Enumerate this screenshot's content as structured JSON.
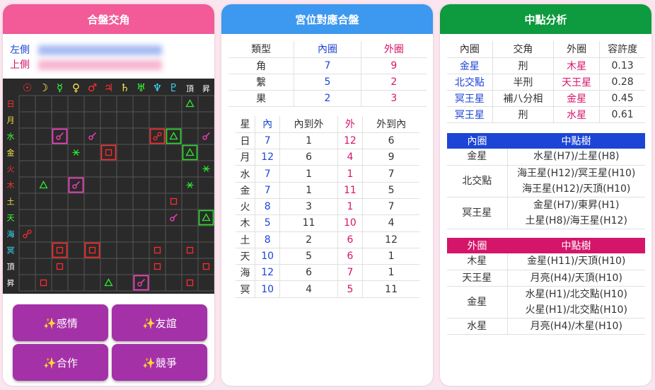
{
  "panel1": {
    "title": "合盤交角",
    "left_label": "左側",
    "right_label": "上側",
    "glyphs_top": [
      "☉",
      "☽",
      "☿",
      "♀",
      "♂",
      "♃",
      "♄",
      "♅",
      "♆",
      "♇",
      "頂",
      "昇"
    ],
    "glyph_colors": [
      "#ff3030",
      "#ffe64a",
      "#3cff3c",
      "#ffe64a",
      "#ff3030",
      "#ff3030",
      "#ffe64a",
      "#3cff3c",
      "#39e0ff",
      "#39e0ff",
      "#ffffff",
      "#ffffff"
    ],
    "rows": [
      "日",
      "月",
      "水",
      "金",
      "火",
      "木",
      "土",
      "天",
      "海",
      "冥",
      "頂",
      "昇"
    ],
    "aspects": [
      {
        "r": 0,
        "c": 10,
        "t": "tri"
      },
      {
        "r": 2,
        "c": 2,
        "t": "con",
        "box": "pink"
      },
      {
        "r": 2,
        "c": 4,
        "t": "con"
      },
      {
        "r": 2,
        "c": 8,
        "t": "opp",
        "box": "red"
      },
      {
        "r": 2,
        "c": 9,
        "t": "tri",
        "box": "green"
      },
      {
        "r": 2,
        "c": 11,
        "t": "con"
      },
      {
        "r": 3,
        "c": 3,
        "t": "sex"
      },
      {
        "r": 3,
        "c": 5,
        "t": "sq",
        "box": "red"
      },
      {
        "r": 3,
        "c": 10,
        "t": "tri",
        "box": "green"
      },
      {
        "r": 4,
        "c": 11,
        "t": "sex"
      },
      {
        "r": 5,
        "c": 1,
        "t": "tri"
      },
      {
        "r": 5,
        "c": 3,
        "t": "con",
        "box": "pink"
      },
      {
        "r": 5,
        "c": 10,
        "t": "sex"
      },
      {
        "r": 6,
        "c": 9,
        "t": "sq"
      },
      {
        "r": 7,
        "c": 9,
        "t": "con"
      },
      {
        "r": 7,
        "c": 11,
        "t": "tri",
        "box": "green"
      },
      {
        "r": 8,
        "c": 0,
        "t": "opp"
      },
      {
        "r": 9,
        "c": 2,
        "t": "sq",
        "box": "red"
      },
      {
        "r": 9,
        "c": 4,
        "t": "sq",
        "box": "red"
      },
      {
        "r": 9,
        "c": 8,
        "t": "sq"
      },
      {
        "r": 9,
        "c": 10,
        "t": "sq"
      },
      {
        "r": 10,
        "c": 2,
        "t": "sq"
      },
      {
        "r": 10,
        "c": 8,
        "t": "sq"
      },
      {
        "r": 10,
        "c": 11,
        "t": "sq"
      },
      {
        "r": 11,
        "c": 1,
        "t": "sq"
      },
      {
        "r": 11,
        "c": 5,
        "t": "tri"
      },
      {
        "r": 11,
        "c": 7,
        "t": "con",
        "box": "pink"
      },
      {
        "r": 11,
        "c": 10,
        "t": "sq"
      }
    ],
    "buttons": [
      "✨感情",
      "✨友誼",
      "✨合作",
      "✨競爭"
    ]
  },
  "panel2": {
    "title": "宮位對應合盤",
    "summary_headers": [
      "類型",
      "內圈",
      "外圈"
    ],
    "summary_rows": [
      [
        "角",
        "7",
        "9"
      ],
      [
        "繫",
        "5",
        "2"
      ],
      [
        "果",
        "2",
        "3"
      ]
    ],
    "detail_headers": [
      "星",
      "內",
      "內到外",
      "外",
      "外到內"
    ],
    "detail_rows": [
      [
        "日",
        "7",
        "1",
        "12",
        "6"
      ],
      [
        "月",
        "12",
        "6",
        "4",
        "9"
      ],
      [
        "水",
        "7",
        "1",
        "1",
        "7"
      ],
      [
        "金",
        "7",
        "1",
        "11",
        "5"
      ],
      [
        "火",
        "8",
        "3",
        "1",
        "7"
      ],
      [
        "木",
        "5",
        "11",
        "10",
        "4"
      ],
      [
        "土",
        "8",
        "2",
        "6",
        "12"
      ],
      [
        "天",
        "10",
        "5",
        "6",
        "1"
      ],
      [
        "海",
        "12",
        "6",
        "7",
        "1"
      ],
      [
        "冥",
        "10",
        "4",
        "5",
        "11"
      ]
    ]
  },
  "panel3": {
    "title": "中點分析",
    "headers": [
      "內圈",
      "交角",
      "外圈",
      "容許度"
    ],
    "rows": [
      [
        "金星",
        "刑",
        "木星",
        "0.13"
      ],
      [
        "北交點",
        "半刑",
        "天王星",
        "0.28"
      ],
      [
        "冥王星",
        "補八分相",
        "金星",
        "0.45"
      ],
      [
        "冥王星",
        "刑",
        "水星",
        "0.61"
      ]
    ],
    "inner_header": [
      "內圈",
      "中點樹"
    ],
    "inner_rows": [
      {
        "k": "金星",
        "v": [
          "水星(H7)/土星(H8)"
        ]
      },
      {
        "k": "北交點",
        "v": [
          "海王星(H12)/冥王星(H10)",
          "海王星(H12)/天頂(H10)"
        ]
      },
      {
        "k": "冥王星",
        "v": [
          "金星(H7)/東昇(H1)",
          "土星(H8)/海王星(H12)"
        ]
      }
    ],
    "outer_header": [
      "外圈",
      "中點樹"
    ],
    "outer_rows": [
      {
        "k": "木星",
        "v": [
          "金星(H11)/天頂(H10)"
        ]
      },
      {
        "k": "天王星",
        "v": [
          "月亮(H4)/天頂(H10)"
        ]
      },
      {
        "k": "金星",
        "v": [
          "水星(H1)/北交點(H10)",
          "火星(H1)/北交點(H10)"
        ]
      },
      {
        "k": "水星",
        "v": [
          "月亮(H4)/木星(H10)"
        ]
      }
    ]
  },
  "colors": {
    "pink_header": "#f25a98",
    "blue_header": "#3d98f0",
    "green_header": "#0e9a3e",
    "button": "#a531a8",
    "inner_blue": "#1c45d6",
    "outer_pink": "#d4156a"
  }
}
